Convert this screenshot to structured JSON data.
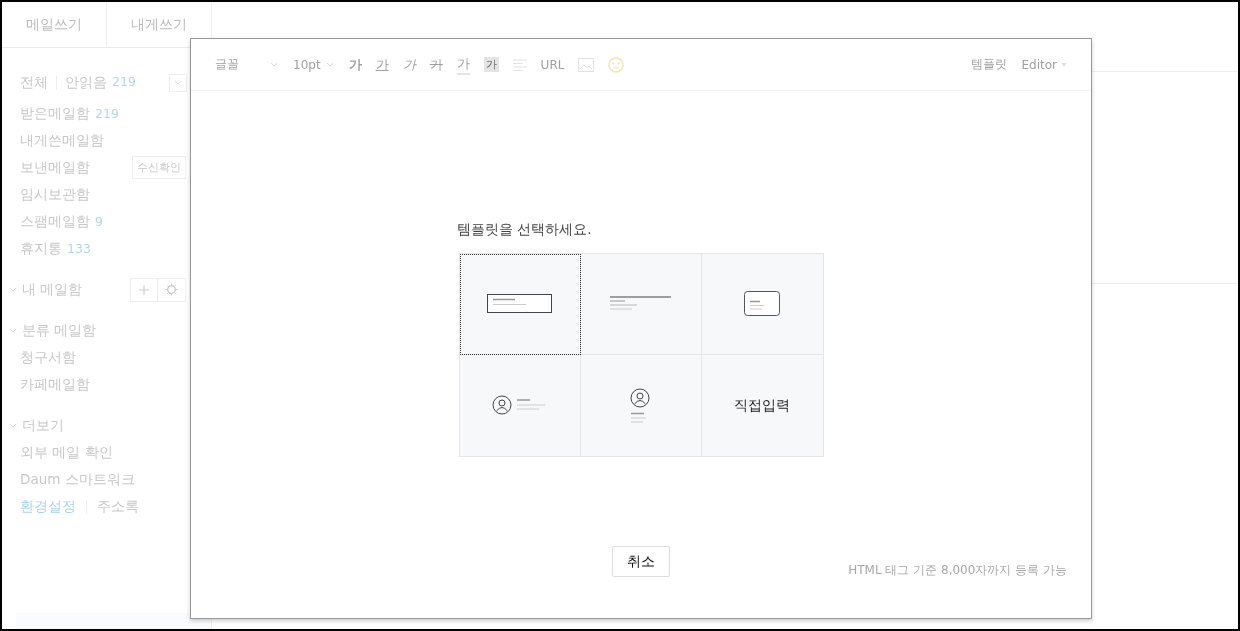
{
  "sidebar": {
    "compose_tabs": [
      {
        "label": "메일쓰기"
      },
      {
        "label": "내게쓰기"
      }
    ],
    "filter": {
      "all": "전체",
      "unread": "안읽음",
      "unread_count": "219"
    },
    "folders": [
      {
        "name": "받은메일함",
        "count": "219"
      },
      {
        "name": "내게쓴메일함"
      },
      {
        "name": "보낸메일함",
        "action": "수신확인"
      },
      {
        "name": "임시보관함"
      },
      {
        "name": "스팸메일함",
        "count": "9"
      },
      {
        "name": "휴지통",
        "count": "133"
      }
    ],
    "sections": [
      {
        "title": "내 메일함",
        "tools": true
      },
      {
        "title": "분류 메일함",
        "items": [
          "청구서함",
          "카페메일함"
        ]
      },
      {
        "title": "더보기",
        "items": [
          "외부 메일 확인",
          "Daum 스마트워크"
        ]
      }
    ],
    "footer_links": [
      {
        "label": "환경설정",
        "selected": true
      },
      {
        "label": "주소록",
        "selected": false
      }
    ]
  },
  "editor": {
    "toolbar": [
      {
        "kind": "dropdown",
        "label": "글꼴"
      },
      {
        "kind": "dropdown",
        "label": "10pt"
      },
      {
        "kind": "bold",
        "label": "가"
      },
      {
        "kind": "underline",
        "label": "가"
      },
      {
        "kind": "italic",
        "label": "가"
      },
      {
        "kind": "strike",
        "label": "가"
      },
      {
        "kind": "color",
        "label": "가"
      },
      {
        "kind": "highlight",
        "label": "가"
      },
      {
        "kind": "align"
      },
      {
        "kind": "text",
        "label": "URL"
      },
      {
        "kind": "image"
      },
      {
        "kind": "emoji"
      }
    ],
    "right_tools": [
      {
        "kind": "text",
        "label": "템플릿"
      },
      {
        "kind": "menu",
        "label": "Editor"
      }
    ],
    "note": "HTML 태그 기준 8,000자까지 등록 가능"
  },
  "template_dialog": {
    "prompt": "템플릿을 선택하세요.",
    "templates": [
      {
        "kind": "box",
        "selected": true
      },
      {
        "kind": "line",
        "selected": false
      },
      {
        "kind": "card",
        "selected": false
      },
      {
        "kind": "avatar-side",
        "selected": false
      },
      {
        "kind": "avatar-top",
        "selected": false
      },
      {
        "kind": "text",
        "label": "직접입력",
        "selected": false
      }
    ],
    "cancel": "취소"
  }
}
